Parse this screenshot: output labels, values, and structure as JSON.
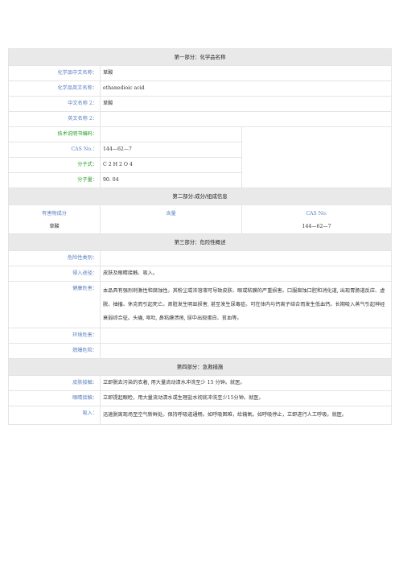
{
  "section1": {
    "title": "第一部分：化学品名称",
    "rows": [
      {
        "label": "化学品中文名称：",
        "value": "草酸"
      },
      {
        "label": "化学品英文名称：",
        "value": "ethanedioic acid"
      },
      {
        "label": "中文名称 2：",
        "value": "草酸"
      },
      {
        "label": "英文名称 2：",
        "value": ""
      }
    ],
    "tech_label": "技术说明书编码：",
    "cas_label": "CAS No.：",
    "cas_value": "144—62—7",
    "formula_label": "分子式：",
    "formula_value": "C 2 H 2 O 4",
    "mw_label": "分子量：",
    "mw_value": "90. 04"
  },
  "section2": {
    "title": "第二部分:成分/组成信息",
    "headers": [
      "有害物成分",
      "含量",
      "CAS No."
    ],
    "component": "草酸",
    "content": "",
    "cas": "144—62—7"
  },
  "section3": {
    "title": "第三部分：危险性概述",
    "category_label": "危险性类别：",
    "category_value": "",
    "route_label": "侵入途径：",
    "route_value": "皮肤及眼睛接触、吸入。",
    "health_label": "健康危害：",
    "health_value": "本品具有强烈刺激性和腐蚀性。其粉尘或浓溶液可导致皮肤、眼或粘膜的严重损害。口服腐蚀口腔和消化道, 出现胃肠道反应、虚脱、抽搐、休克而引起死亡。肾脏发生明显损害, 甚至发生尿毒症。可在体内与钙离子结合而发生低血钙。长期吸入蒸气引起神经衰弱综合征。头痛, 呕吐, 鼻粘膜溃疡, 尿中出现蛋白、贫血等。",
    "env_label": "环境危害：",
    "env_value": "",
    "fire_label": "燃爆危险：",
    "fire_value": ""
  },
  "section4": {
    "title": "第四部分：急救措施",
    "skin_label": "皮肤接触：",
    "skin_value": "立即脱去污染的衣着, 用大量流动清水冲洗至少 15 分钟。就医。",
    "eye_label": "眼睛接触：",
    "eye_value": "立即提起眼睑，用大量流动清水或生理盐水彻底冲洗至少15分钟。就医。",
    "inhale_label": "吸入：",
    "inhale_value": "迅速脱离现场至空气新鲜处。保持呼吸道通畅。如呼吸困难，给输氧。如呼吸停止，立即进行人工呼吸。就医。"
  }
}
